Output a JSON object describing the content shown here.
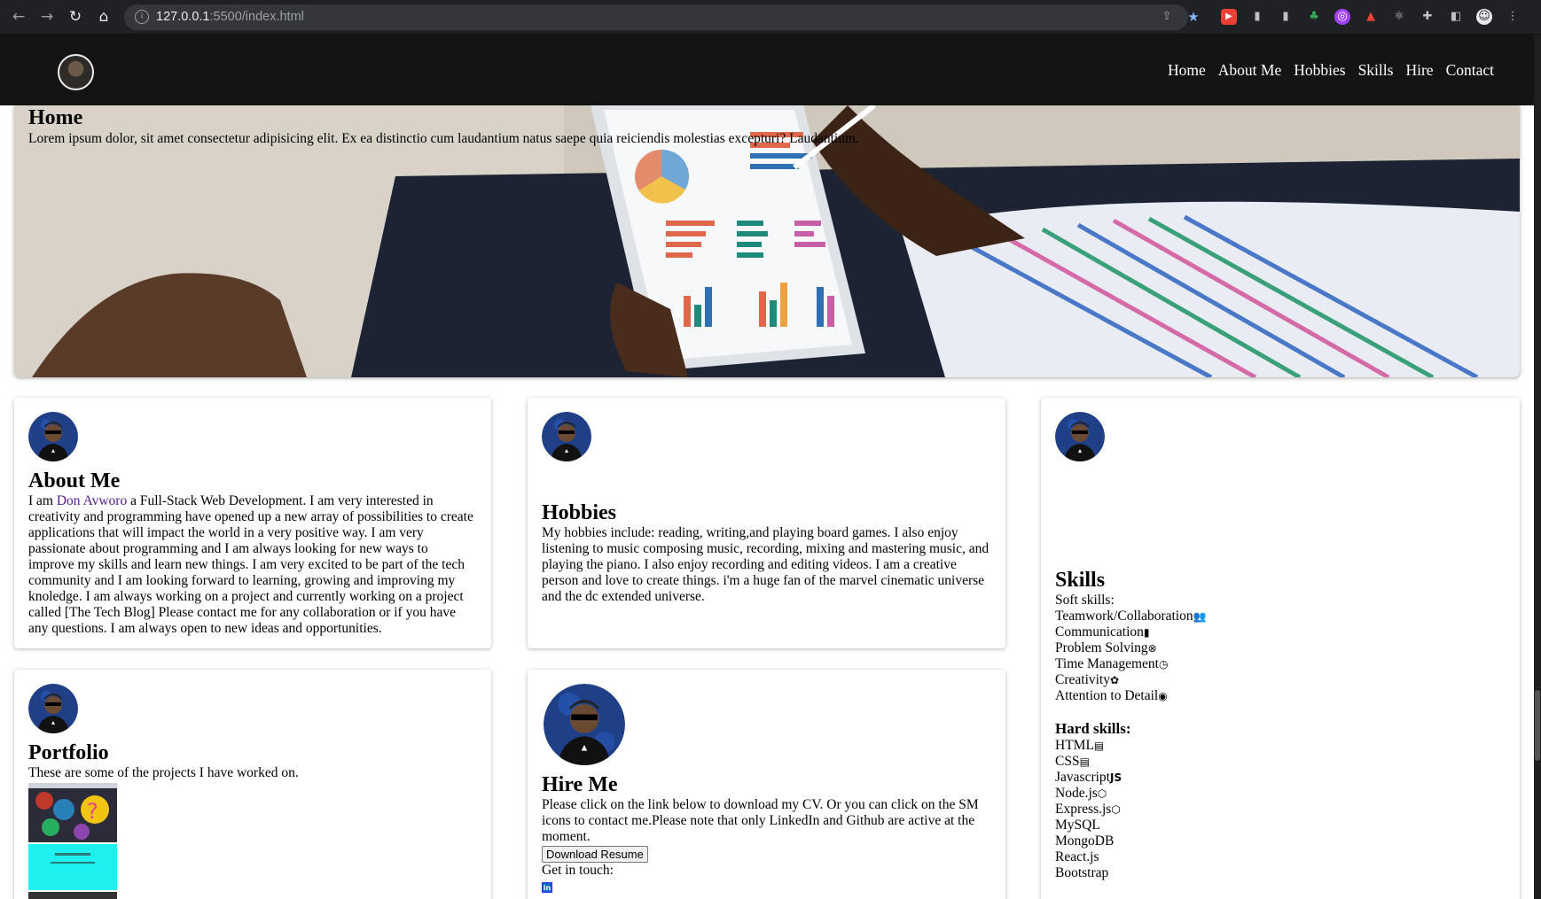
{
  "browser": {
    "url_host": "127.0.0.1",
    "url_path": ":5500/index.html"
  },
  "nav": {
    "items": [
      "Home",
      "About Me",
      "Hobbies",
      "Skills",
      "Hire",
      "Contact"
    ]
  },
  "hero": {
    "title": "Home",
    "text": "Lorem ipsum dolor, sit amet consectetur adipisicing elit. Ex ea distinctio cum laudantium natus saepe quia reiciendis molestias excepturi? Laudantium."
  },
  "about": {
    "title": "About Me",
    "text_before": "I am ",
    "name": "Don Avworo",
    "text_after": " a Full-Stack Web Development. I am very interested in creativity and programming have opened up a new array of possibilities to create applications that will impact the world in a very positive way. I am very passionate about programming and I am always looking for new ways to improve my skills and learn new things. I am very excited to be part of the tech community and I am looking forward to learning, growing and improving my knoledge. I am always working on a project and currently working on a project called [The Tech Blog] Please contact me for any collaboration or if you have any questions. I am always open to new ideas and opportunities."
  },
  "hobbies": {
    "title": "Hobbies",
    "text": "My hobbies include: reading, writing,and playing board games. I also enjoy listening to music composing music, recording, mixing and mastering music, and playing the piano. I also enjoy recording and editing videos. I am a creative person and love to create things. i'm a huge fan of the marvel cinematic universe and the dc extended universe."
  },
  "skills": {
    "title": "Skills",
    "soft_label": "Soft skills:",
    "soft": [
      {
        "label": "Teamwork/Collaboration",
        "icon": "users-icon",
        "glyph": "👥"
      },
      {
        "label": "Communication",
        "icon": "chat-icon",
        "glyph": "▮"
      },
      {
        "label": "Problem Solving",
        "icon": "gear-icon",
        "glyph": "⊗"
      },
      {
        "label": "Time Management",
        "icon": "clock-icon",
        "glyph": "◷"
      },
      {
        "label": "Creativity",
        "icon": "palette-icon",
        "glyph": "✿"
      },
      {
        "label": "Attention to Detail",
        "icon": "eye-icon",
        "glyph": "◉"
      }
    ],
    "hard_label": "Hard skills:",
    "hard": [
      {
        "label": "HTML",
        "icon": "html5-icon",
        "glyph": "▤"
      },
      {
        "label": "CSS",
        "icon": "css3-icon",
        "glyph": "▤"
      },
      {
        "label": "Javascript",
        "icon": "js-icon",
        "glyph": "JS"
      },
      {
        "label": "Node.js",
        "icon": "nodejs-icon",
        "glyph": "⬡"
      },
      {
        "label": "Express.js",
        "icon": "nodejs-icon",
        "glyph": "⬡"
      },
      {
        "label": "MySQL",
        "icon": "",
        "glyph": ""
      },
      {
        "label": "MongoDB",
        "icon": "",
        "glyph": ""
      },
      {
        "label": "React.js",
        "icon": "",
        "glyph": ""
      },
      {
        "label": "Bootstrap",
        "icon": "",
        "glyph": ""
      }
    ]
  },
  "portfolio": {
    "title": "Portfolio",
    "text": "These are some of the projects I have worked on."
  },
  "hire": {
    "title": "Hire Me",
    "text": "Please click on the link below to download my CV. Or you can click on the SM icons to contact me.Please note that only LinkedIn and Github are active at the moment.",
    "button": "Download Resume",
    "get_in_touch": "Get in touch:"
  }
}
